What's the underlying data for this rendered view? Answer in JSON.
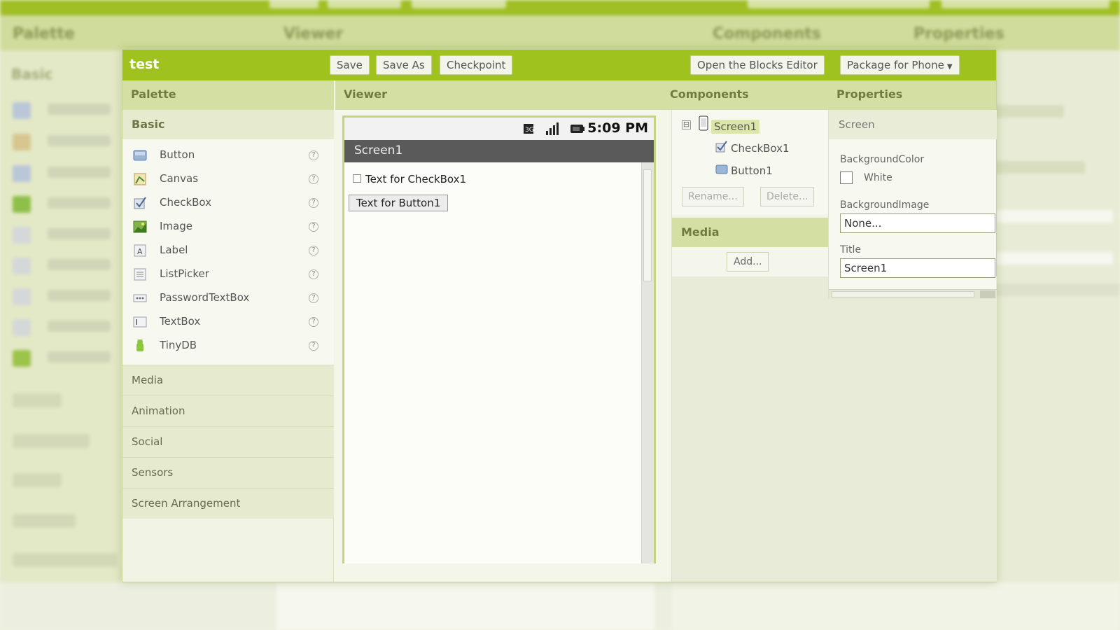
{
  "app": {
    "title": "test"
  },
  "toolbar": {
    "save": "Save",
    "save_as": "Save As",
    "checkpoint": "Checkpoint",
    "open_blocks": "Open the Blocks Editor",
    "package": "Package for Phone"
  },
  "headers": {
    "palette": "Palette",
    "viewer": "Viewer",
    "components": "Components",
    "properties": "Properties"
  },
  "palette": {
    "basic_label": "Basic",
    "items": [
      {
        "label": "Button",
        "icon": "button-icon"
      },
      {
        "label": "Canvas",
        "icon": "canvas-icon"
      },
      {
        "label": "CheckBox",
        "icon": "checkbox-icon"
      },
      {
        "label": "Image",
        "icon": "image-icon"
      },
      {
        "label": "Label",
        "icon": "label-icon"
      },
      {
        "label": "ListPicker",
        "icon": "listpicker-icon"
      },
      {
        "label": "PasswordTextBox",
        "icon": "password-icon"
      },
      {
        "label": "TextBox",
        "icon": "textbox-icon"
      },
      {
        "label": "TinyDB",
        "icon": "tinydb-icon"
      }
    ],
    "help_glyph": "?",
    "categories": [
      "Media",
      "Animation",
      "Social",
      "Sensors",
      "Screen Arrangement"
    ]
  },
  "viewer": {
    "status_time": "5:09 PM",
    "screen_title": "Screen1",
    "checkbox_text": "Text for CheckBox1",
    "button_text": "Text for Button1"
  },
  "components": {
    "tree_toggle": "⊟",
    "root": "Screen1",
    "children": [
      "CheckBox1",
      "Button1"
    ],
    "rename": "Rename...",
    "delete": "Delete...",
    "media_header": "Media",
    "add": "Add..."
  },
  "properties": {
    "component": "Screen",
    "background_color_label": "BackgroundColor",
    "background_color_value": "White",
    "background_image_label": "BackgroundImage",
    "background_image_value": "None...",
    "title_label": "Title",
    "title_value": "Screen1"
  },
  "colors": {
    "accent": "#9fc21f",
    "header_bg": "#d4e0a3",
    "panel_bg": "#f3f5e8"
  }
}
